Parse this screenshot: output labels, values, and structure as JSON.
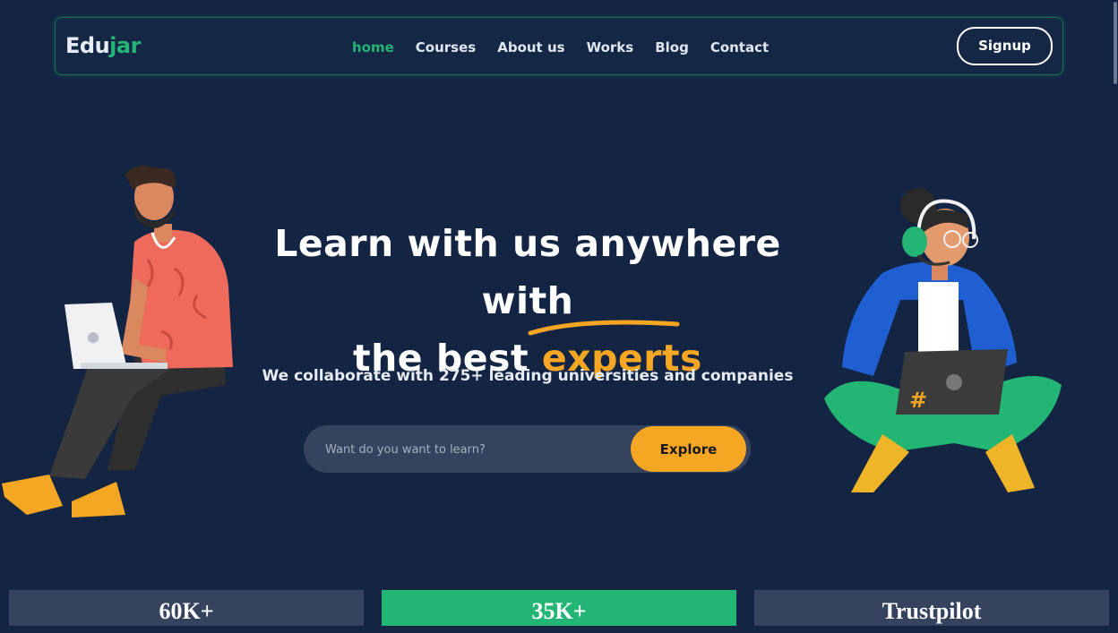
{
  "brand": {
    "logo_part1": "Edu",
    "logo_part2": "jar",
    "accent_green": "#25b475",
    "accent_orange": "#f5a623",
    "background": "#132543"
  },
  "nav": {
    "links": [
      {
        "label": "home",
        "active": true
      },
      {
        "label": "Courses",
        "active": false
      },
      {
        "label": "About us",
        "active": false
      },
      {
        "label": "Works",
        "active": false
      },
      {
        "label": "Blog",
        "active": false
      },
      {
        "label": "Contact",
        "active": false
      }
    ],
    "signup_label": "Signup"
  },
  "hero": {
    "title_line1": "Learn with us anywhere with",
    "title_line2_prefix": "the best ",
    "title_line2_accent": "experts",
    "subtitle": "We collaborate with 275+ leading universities and companies"
  },
  "search": {
    "placeholder": "Want do you want to learn?",
    "value": "",
    "button_label": "Explore"
  },
  "stats": [
    {
      "label": "60K+"
    },
    {
      "label": "35K+"
    },
    {
      "label": "Trustpilot"
    }
  ],
  "illustrations": {
    "left": "man-with-laptop-illustration",
    "right": "woman-with-headset-laptop-illustration"
  }
}
